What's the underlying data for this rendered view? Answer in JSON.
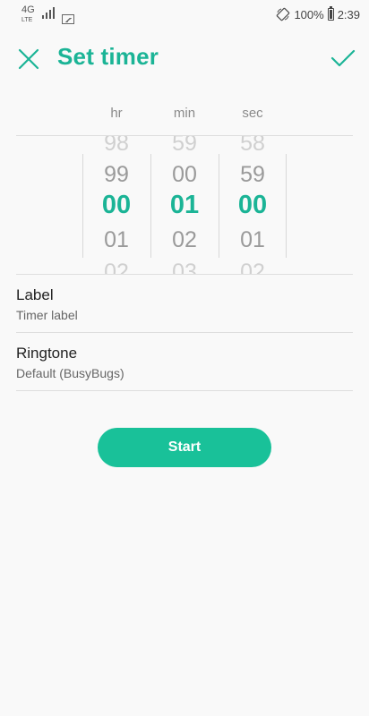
{
  "status_bar": {
    "network": "4G",
    "network_sup": "LTE",
    "battery": "100%",
    "time": "2:39",
    "icons": [
      "signal-icon",
      "image-notification-icon",
      "auto-rotate-icon",
      "battery-icon"
    ]
  },
  "header": {
    "title": "Set timer",
    "close_icon": "close-icon",
    "confirm_icon": "check-icon"
  },
  "picker": {
    "columns": [
      {
        "label": "hr",
        "values": [
          "98",
          "99",
          "00",
          "01",
          "02"
        ],
        "selected": "00"
      },
      {
        "label": "min",
        "values": [
          "59",
          "00",
          "01",
          "02",
          "03"
        ],
        "selected": "01"
      },
      {
        "label": "sec",
        "values": [
          "58",
          "59",
          "00",
          "01",
          "02"
        ],
        "selected": "00"
      }
    ]
  },
  "label_row": {
    "title": "Label",
    "value": "Timer label"
  },
  "ringtone_row": {
    "title": "Ringtone",
    "value": "Default (BusyBugs)"
  },
  "start_button": {
    "label": "Start"
  },
  "colors": {
    "accent": "#1bb496",
    "button": "#19c199",
    "background": "#f9f9f9"
  }
}
